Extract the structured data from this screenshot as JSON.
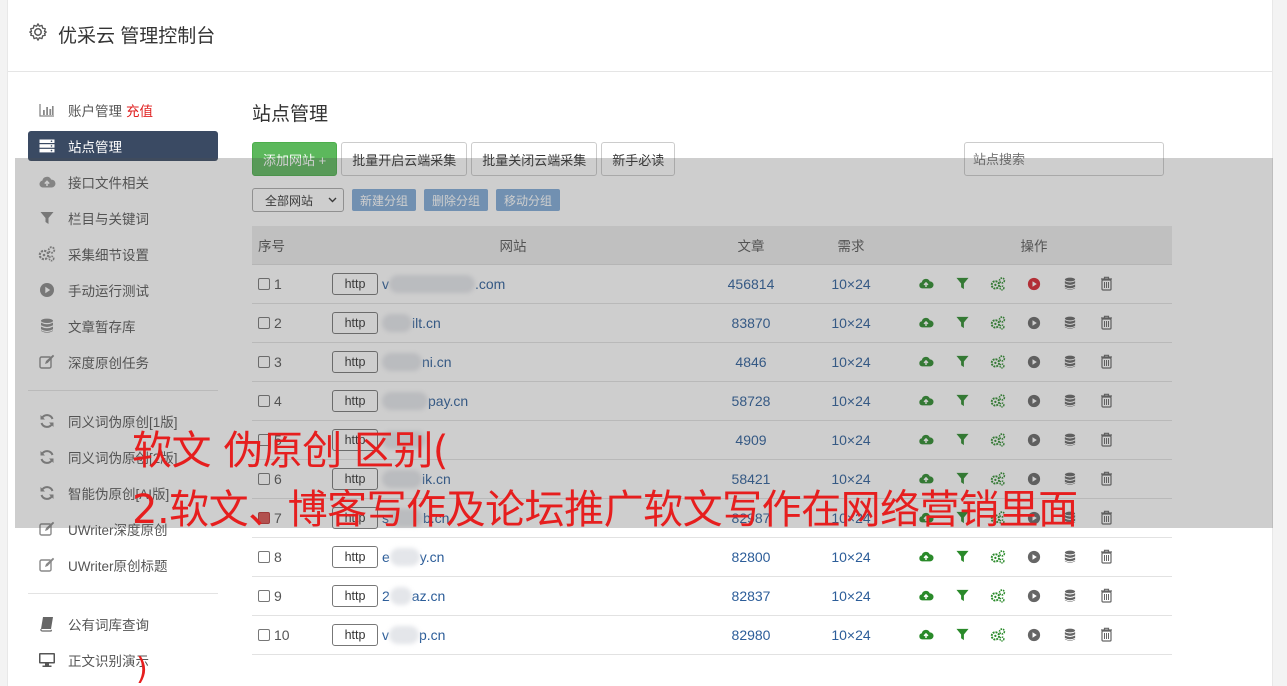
{
  "app": {
    "title": "优采云 管理控制台"
  },
  "sidebar": {
    "items": [
      {
        "label": "账户管理",
        "extra": "充值",
        "icon": "bar-chart-icon"
      },
      {
        "label": "站点管理",
        "icon": "server-icon",
        "active": true
      },
      {
        "label": "接口文件相关",
        "icon": "cloud-upload-icon"
      },
      {
        "label": "栏目与关键词",
        "icon": "filter-icon"
      },
      {
        "label": "采集细节设置",
        "icon": "gears-icon"
      },
      {
        "label": "手动运行测试",
        "icon": "play-circle-icon"
      },
      {
        "label": "文章暂存库",
        "icon": "database-icon"
      },
      {
        "label": "深度原创任务",
        "icon": "edit-icon"
      },
      {
        "label": "同义词伪原创[1版]",
        "icon": "refresh-icon"
      },
      {
        "label": "同义词伪原创[2版]",
        "icon": "refresh-icon"
      },
      {
        "label": "智能伪原创[AI版]",
        "icon": "refresh-icon"
      },
      {
        "label": "UWriter深度原创",
        "icon": "edit-icon"
      },
      {
        "label": "UWriter原创标题",
        "icon": "edit-icon"
      },
      {
        "label": "公有词库查询",
        "icon": "book-icon"
      },
      {
        "label": "正文识别演示",
        "icon": "monitor-icon"
      }
    ]
  },
  "main": {
    "title": "站点管理",
    "toolbar": {
      "add": "添加网站 +",
      "batch_on": "批量开启云端采集",
      "batch_off": "批量关闭云端采集",
      "guide": "新手必读"
    },
    "search_placeholder": "站点搜索",
    "group_select": "全部网站",
    "group_buttons": {
      "new": "新建分组",
      "delete": "删除分组",
      "move": "移动分组"
    },
    "table": {
      "headers": {
        "no": "序号",
        "site": "网站",
        "articles": "文章",
        "req": "需求",
        "ops": "操作"
      },
      "http_label": "http",
      "rows": [
        {
          "no": "1",
          "prefix": "v",
          "domain": ".com",
          "articles": "456814",
          "req": "10×24",
          "checked": false,
          "run_active": true
        },
        {
          "no": "2",
          "prefix": "",
          "domain": "ilt.cn",
          "articles": "83870",
          "req": "10×24",
          "checked": false,
          "run_active": false
        },
        {
          "no": "3",
          "prefix": "",
          "domain": "ni.cn",
          "articles": "4846",
          "req": "10×24",
          "checked": false,
          "run_active": false
        },
        {
          "no": "4",
          "prefix": "",
          "domain": "pay.cn",
          "articles": "58728",
          "req": "10×24",
          "checked": false,
          "run_active": false
        },
        {
          "no": "5",
          "prefix": "",
          "domain": "",
          "articles": "4909",
          "req": "10×24",
          "checked": false,
          "run_active": false
        },
        {
          "no": "6",
          "prefix": "",
          "domain": "ik.cn",
          "articles": "58421",
          "req": "10×24",
          "checked": false,
          "run_active": false
        },
        {
          "no": "7",
          "prefix": "s",
          "domain": "b.cn",
          "articles": "82987",
          "req": "10×24",
          "checked": true,
          "run_active": false
        },
        {
          "no": "8",
          "prefix": "e",
          "domain": "y.cn",
          "articles": "82800",
          "req": "10×24",
          "checked": false,
          "run_active": false
        },
        {
          "no": "9",
          "prefix": "2",
          "domain": "az.cn",
          "articles": "82837",
          "req": "10×24",
          "checked": false,
          "run_active": false
        },
        {
          "no": "10",
          "prefix": "v",
          "domain": "p.cn",
          "articles": "82980",
          "req": "10×24",
          "checked": false,
          "run_active": false
        }
      ]
    }
  },
  "overlay": {
    "line1": "软文 伪原创 区别(",
    "line2": "2.软文、博客写作及论坛推广软文写作在网络营销里面",
    "paren": ")"
  },
  "colors": {
    "accent_green": "#5cb85c",
    "nav_active": "#3a4a63",
    "link": "#2c5d99",
    "overlay_text": "#e61e1e"
  }
}
